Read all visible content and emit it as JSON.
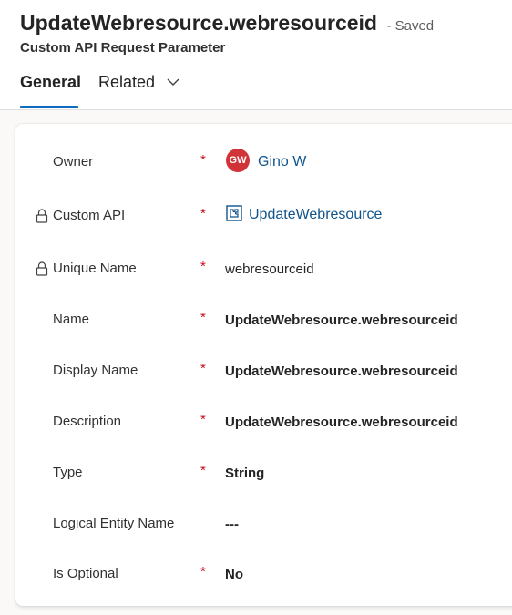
{
  "record": {
    "title": "UpdateWebresource.webresourceid",
    "status": "- Saved",
    "entity_type": "Custom API Request Parameter"
  },
  "tabs": [
    {
      "label": "General",
      "selected": true
    },
    {
      "label": "Related",
      "selected": false,
      "icon": "chevron-down-icon"
    }
  ],
  "colors": {
    "accent": "#0f6cbd",
    "link": "#0f548c",
    "required": "#c50f1f",
    "avatar_bg": "#d13438"
  },
  "form": {
    "required_marker": "*",
    "fields": [
      {
        "label": "Owner",
        "required": true,
        "avatar_initials": "GW",
        "value": "Gino W"
      },
      {
        "label": "Custom API",
        "required": true,
        "locked": true,
        "icon": "entity-icon",
        "value": "UpdateWebresource"
      },
      {
        "label": "Unique Name",
        "required": true,
        "locked": true,
        "value": "webresourceid"
      },
      {
        "label": "Name",
        "required": true,
        "value": "UpdateWebresource.webresourceid"
      },
      {
        "label": "Display Name",
        "required": true,
        "value": "UpdateWebresource.webresourceid"
      },
      {
        "label": "Description",
        "required": true,
        "value": "UpdateWebresource.webresourceid"
      },
      {
        "label": "Type",
        "required": true,
        "value": "String"
      },
      {
        "label": "Logical Entity Name",
        "required": false,
        "value": "---"
      },
      {
        "label": "Is Optional",
        "required": true,
        "value": "No"
      }
    ]
  }
}
